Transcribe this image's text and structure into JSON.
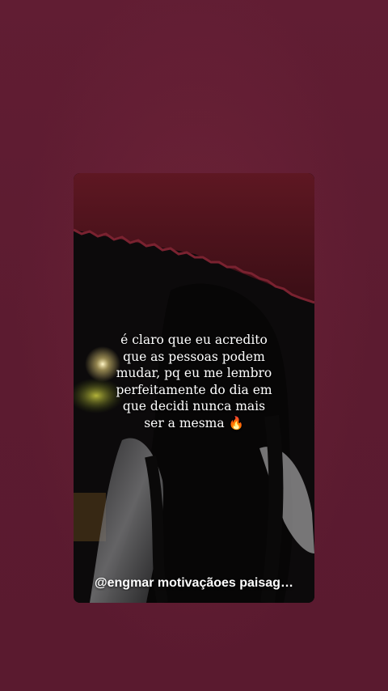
{
  "quote": {
    "lines": [
      "é claro que eu acredito",
      "que as pessoas podem",
      "mudar, pq eu me lembro",
      "perfeitamente do dia em",
      "que decidi nunca mais",
      "ser a mesma 🔥"
    ]
  },
  "credit": "@engmar motivaçãoes paisag…",
  "colors": {
    "background": "#5f1d32",
    "card": "#0b0a0b",
    "text": "#ffffff"
  },
  "icons": [
    "fire-emoji"
  ]
}
